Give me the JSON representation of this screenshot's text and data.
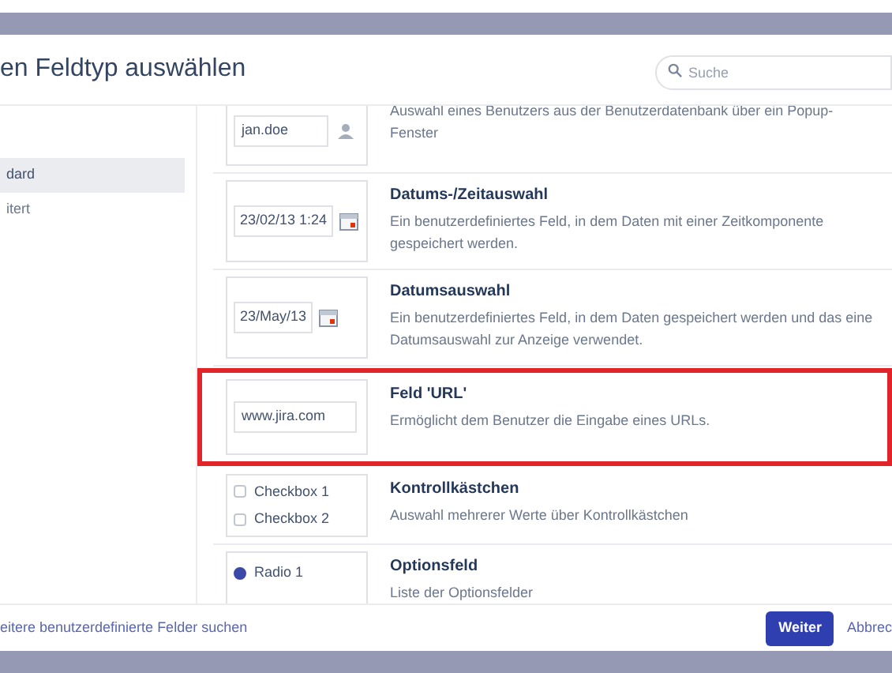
{
  "dialog": {
    "title": "en Feldtyp auswählen",
    "search": {
      "placeholder": "Suche"
    }
  },
  "sidebar": {
    "items": [
      {
        "label": "dard",
        "selected": true
      },
      {
        "label": "itert",
        "selected": false
      }
    ]
  },
  "field_types": [
    {
      "kind": "user",
      "highlighted": false,
      "preview": "jan.doe",
      "description": "Auswahl eines Benutzers aus der Benutzerdatenbank über ein Popup-Fenster"
    },
    {
      "kind": "datetime",
      "highlighted": false,
      "name": "Datums-/Zeitauswahl",
      "preview": "23/02/13 1:24",
      "description": "Ein benutzerdefiniertes Feld, in dem Daten mit einer Zeitkomponente gespeichert werden."
    },
    {
      "kind": "date",
      "highlighted": false,
      "name": "Datumsauswahl",
      "preview": "23/May/13",
      "description": "Ein benutzerdefiniertes Feld, in dem Daten gespeichert werden und das eine Datumsauswahl zur Anzeige verwendet."
    },
    {
      "kind": "url",
      "highlighted": true,
      "name": "Feld 'URL'",
      "preview": "www.jira.com",
      "description": "Ermöglicht dem Benutzer die Eingabe eines URLs."
    },
    {
      "kind": "checkbox",
      "highlighted": false,
      "name": "Kontrollkästchen",
      "options": [
        {
          "label": "Checkbox 1",
          "checked": false
        },
        {
          "label": "Checkbox 2",
          "checked": false
        }
      ],
      "description": "Auswahl mehrerer Werte über Kontrollkästchen"
    },
    {
      "kind": "radio",
      "highlighted": false,
      "name": "Optionsfeld",
      "options": [
        {
          "label": "Radio 1",
          "selected": true
        }
      ],
      "description": "Liste der Optionsfelder"
    }
  ],
  "footer": {
    "link": "eitere benutzerdefinierte Felder suchen",
    "primary_button": "Weiter",
    "cancel_link": "Abbrec"
  }
}
